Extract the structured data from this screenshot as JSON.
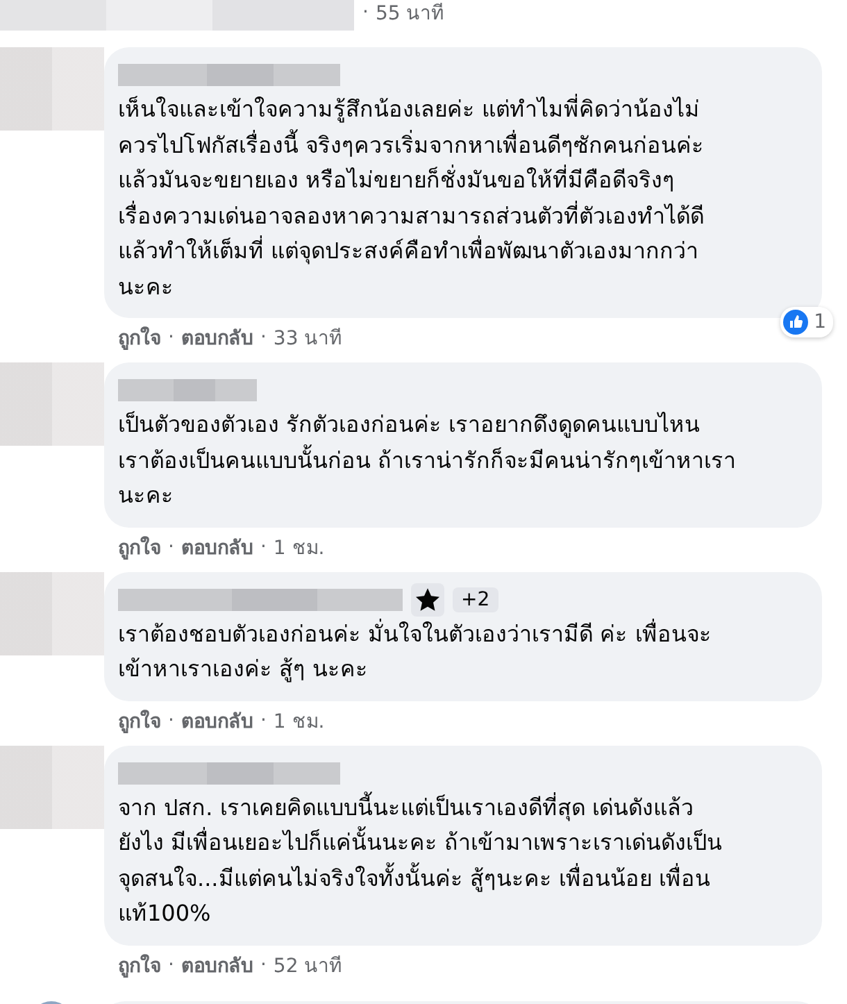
{
  "top": {
    "separator": "·",
    "time": "55 นาที"
  },
  "comments": [
    {
      "text": "เห็นใจและเข้าใจความรู้สึกน้องเลยค่ะ แต่ทำไมพี่คิดว่าน้องไม่\nควรไปโฟกัสเรื่องนี้ จริงๆควรเริ่มจากหาเพื่อนดีๆซักคนก่อนค่ะ\nแล้วมันจะขยายเอง หรือไม่ขยายก็ชั่งมันขอให้ที่มีคือดีจริงๆ\nเรื่องความเด่นอาจลองหาความสามารถส่วนตัวที่ตัวเองทำได้ดี\nแล้วทำให้เต็มที่ แต่จุดประสงค์คือทำเพื่อพัฒนาตัวเองมากกว่า\nนะคะ",
      "reaction": {
        "count": "1"
      },
      "like": "ถูกใจ",
      "sep": "·",
      "reply": "ตอบกลับ",
      "time": "33 นาที"
    },
    {
      "text": "เป็นตัวของตัวเอง รักตัวเองก่อนค่ะ เราอยากดึงดูดคนแบบไหน\nเราต้องเป็นคนแบบนั้นก่อน ถ้าเราน่ารักก็จะมีคนน่ารักๆเข้าหาเรา\nนะคะ",
      "like": "ถูกใจ",
      "sep": "·",
      "reply": "ตอบกลับ",
      "time": "1 ชม."
    },
    {
      "text": "เราต้องชอบตัวเองก่อนค่ะ มั่นใจในตัวเองว่าเรามีดี ค่ะ เพื่อนจะ\nเข้าหาเราเองค่ะ สู้ๆ นะคะ",
      "badge": {
        "more": "+2"
      },
      "like": "ถูกใจ",
      "sep": "·",
      "reply": "ตอบกลับ",
      "time": "1 ชม."
    },
    {
      "text": "จาก ปสก. เราเคยคิดแบบนี้นะแต่เป็นเราเองดีที่สุด เด่นดังแล้ว\nยังไง มีเพื่อนเยอะไปก็แค่นั้นนะคะ ถ้าเข้ามาเพราะเราเด่นดังเป็น\nจุดสนใจ...มีแต่คนไม่จริงใจทั้งนั้นค่ะ สู้ๆนะคะ เพื่อนน้อย เพื่อน\nแท้100%",
      "like": "ถูกใจ",
      "sep": "·",
      "reply": "ตอบกลับ",
      "time": "52 นาที"
    }
  ]
}
